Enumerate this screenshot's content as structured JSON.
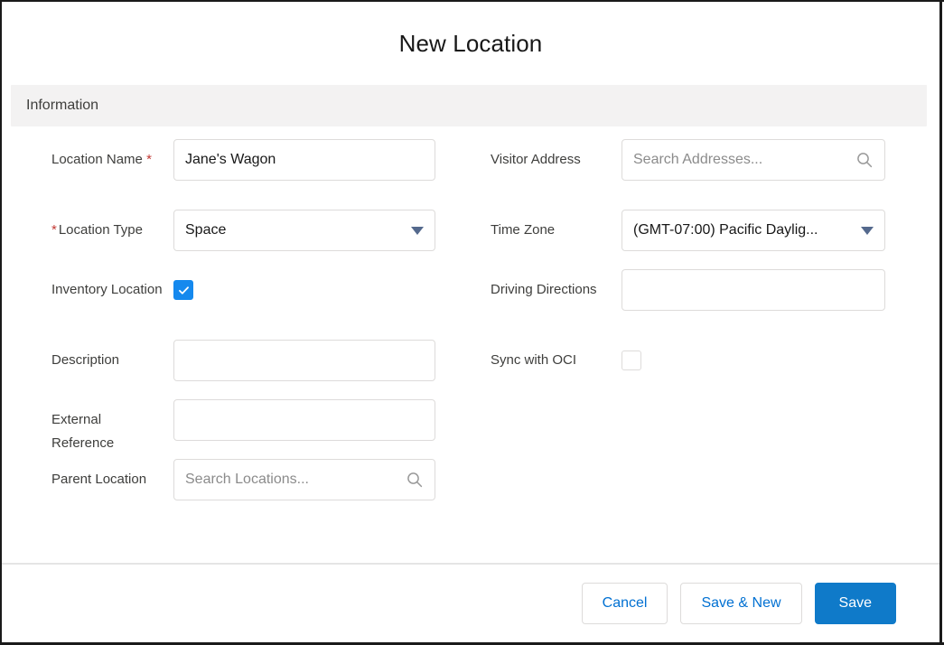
{
  "modal": {
    "title": "New Location",
    "section": {
      "title": "Information"
    }
  },
  "fields": {
    "location_name": {
      "label": "Location Name",
      "required_marker": "*",
      "value": "Jane's Wagon",
      "placeholder": ""
    },
    "location_type": {
      "label": "Location Type",
      "required_marker": "*",
      "value": "Space",
      "icon": "chevron-down-icon"
    },
    "inventory_location": {
      "label": "Inventory Location",
      "checked": true
    },
    "description": {
      "label": "Description",
      "value": "",
      "placeholder": ""
    },
    "external_reference": {
      "label": "External Reference",
      "value": "",
      "placeholder": ""
    },
    "parent_location": {
      "label": "Parent Location",
      "value": "",
      "placeholder": "Search Locations...",
      "icon": "search-icon"
    },
    "visitor_address": {
      "label": "Visitor Address",
      "value": "",
      "placeholder": "Search Addresses...",
      "icon": "search-icon"
    },
    "time_zone": {
      "label": "Time Zone",
      "value": "(GMT-07:00) Pacific Daylig...",
      "icon": "chevron-down-icon"
    },
    "driving_directions": {
      "label": "Driving Directions",
      "value": "",
      "placeholder": ""
    },
    "sync_with_oci": {
      "label": "Sync with OCI",
      "checked": false
    }
  },
  "footer": {
    "cancel_label": "Cancel",
    "save_new_label": "Save & New",
    "save_label": "Save"
  },
  "colors": {
    "brand_blue": "#0f7ac9",
    "link_blue": "#0070d2",
    "checkbox_blue": "#1589ee",
    "required_red": "#c23934",
    "section_bg": "#f3f2f2",
    "border_gray": "#dddbda"
  }
}
